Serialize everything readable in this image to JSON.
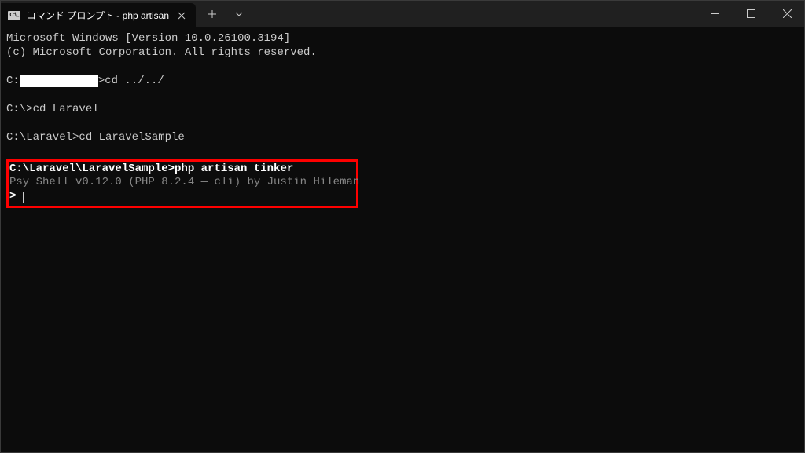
{
  "tab": {
    "title": "コマンド プロンプト - php  artisan",
    "icon_text": "C:\\_"
  },
  "terminal": {
    "version_line": "Microsoft Windows [Version 10.0.26100.3194]",
    "copyright_line": "(c) Microsoft Corporation. All rights reserved.",
    "prompt1_before": "C:",
    "prompt1_after": ">cd ../../",
    "prompt2": "C:\\>cd Laravel",
    "prompt3": "C:\\Laravel>cd LaravelSample",
    "hl_cmd": "C:\\Laravel\\LaravelSample>php artisan tinker",
    "hl_psy": "Psy Shell v0.12.0 (PHP 8.2.4 — cli) by Justin Hileman",
    "hl_prompt": "> "
  }
}
